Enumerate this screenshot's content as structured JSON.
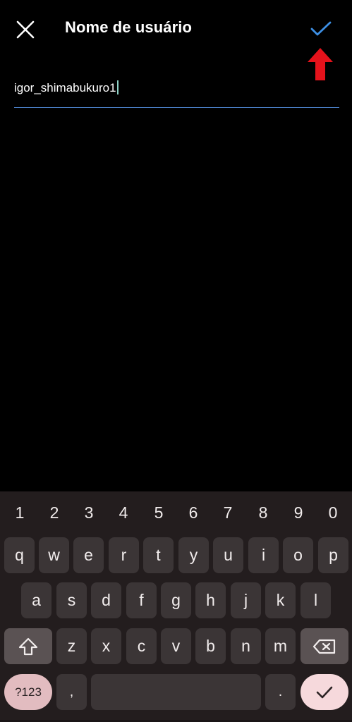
{
  "header": {
    "title": "Nome de usuário"
  },
  "form": {
    "username_value": "igor_shimabukuro1"
  },
  "colors": {
    "confirm_check": "#3d8fe4",
    "arrow_annotation": "#e5121b",
    "field_underline": "#4b7fc7"
  },
  "icons": {
    "close": "close-icon",
    "confirm": "checkmark-icon",
    "annotation": "red-up-arrow",
    "shift": "shift-icon",
    "backspace": "backspace-icon",
    "enter": "check-enter-icon"
  },
  "keyboard": {
    "numbers": [
      "1",
      "2",
      "3",
      "4",
      "5",
      "6",
      "7",
      "8",
      "9",
      "0"
    ],
    "row1": [
      "q",
      "w",
      "e",
      "r",
      "t",
      "y",
      "u",
      "i",
      "o",
      "p"
    ],
    "row2": [
      "a",
      "s",
      "d",
      "f",
      "g",
      "h",
      "j",
      "k",
      "l"
    ],
    "row3": [
      "z",
      "x",
      "c",
      "v",
      "b",
      "n",
      "m"
    ],
    "symbols_label": "?123",
    "comma_label": ",",
    "period_label": "."
  }
}
